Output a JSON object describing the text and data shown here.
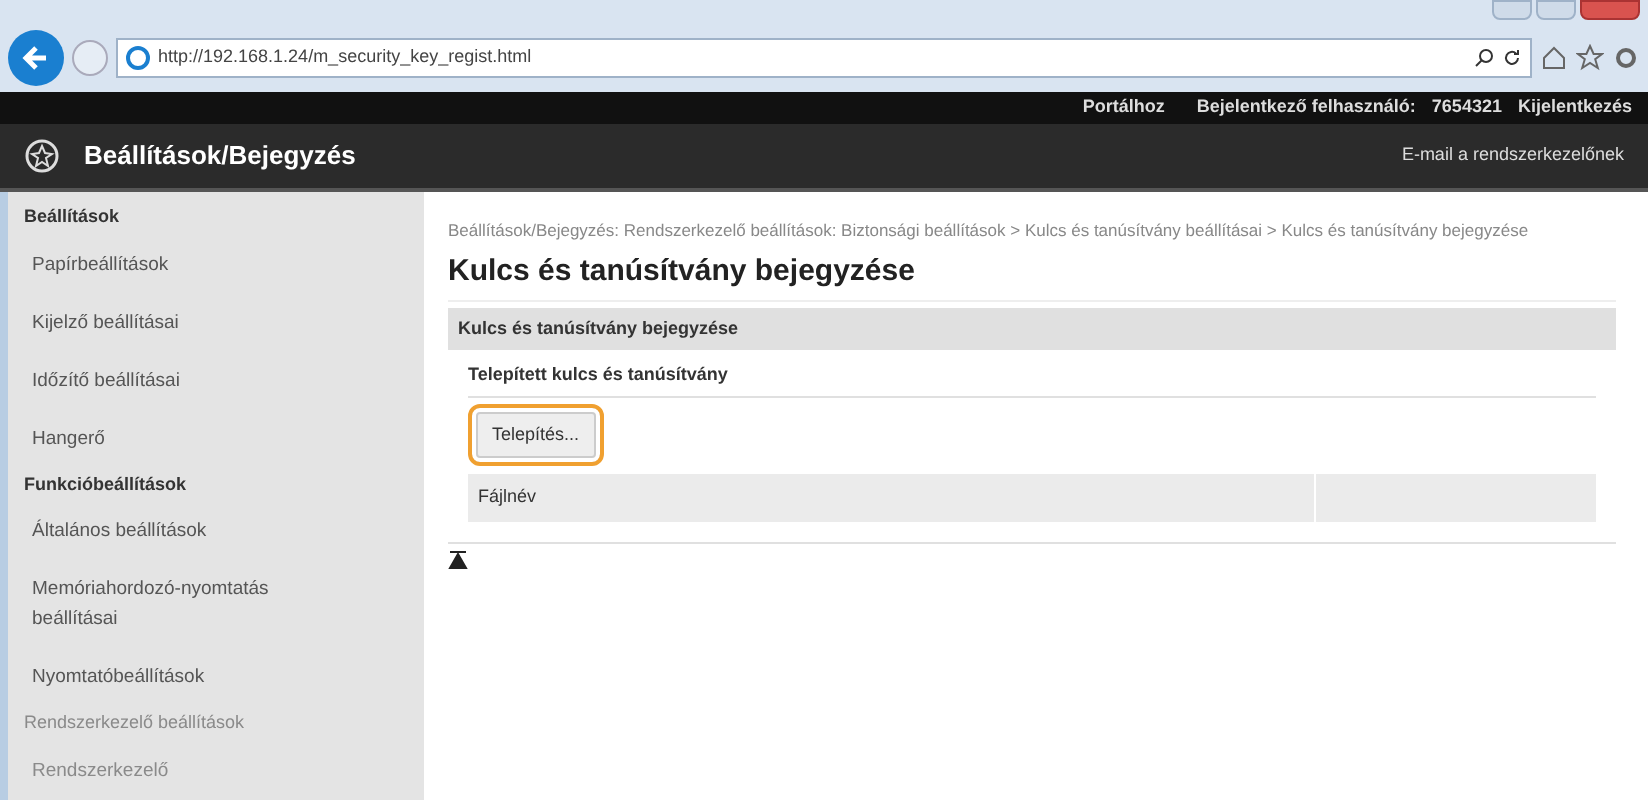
{
  "browser": {
    "url": "http://192.168.1.24/m_security_key_regist.html"
  },
  "top_bar": {
    "links": [
      "Portálhoz"
    ],
    "login_label": "Bejelentkező felhasználó:",
    "user_id": "7654321",
    "logout": "Kijelentkezés"
  },
  "header": {
    "title": "Beállítások/Bejegyzés",
    "email_link": "E-mail a rendszerkezelőnek"
  },
  "sidebar": {
    "sections": [
      {
        "title": "Beállítások",
        "faded": false,
        "items": [
          {
            "label": "Papírbeállítások"
          },
          {
            "label": "Kijelző beállításai"
          },
          {
            "label": "Időzítő beállításai"
          },
          {
            "label": "Hangerő"
          }
        ]
      },
      {
        "title": "Funkcióbeállítások",
        "faded": false,
        "items": [
          {
            "label": "Általános beállítások"
          },
          {
            "label": "Memóriahordozó-nyomtatás beállításai"
          },
          {
            "label": "Nyomtatóbeállítások"
          }
        ]
      },
      {
        "title": "Rendszerkezelő beállítások",
        "faded": true,
        "items": [
          {
            "label": "Rendszerkezelő"
          }
        ]
      }
    ]
  },
  "content": {
    "breadcrumb": "Beállítások/Bejegyzés: Rendszerkezelő beállítások: Biztonsági beállítások > Kulcs és tanúsítvány beállításai > Kulcs és tanúsítvány bejegyzése",
    "title": "Kulcs és tanúsítvány bejegyzése",
    "section_title": "Kulcs és tanúsítvány bejegyzése",
    "subsection_title": "Telepített kulcs és tanúsítvány",
    "install_button": {
      "label": "Telepítés...",
      "highlighted": true
    },
    "table": {
      "columns": [
        "Fájlnév"
      ]
    }
  }
}
